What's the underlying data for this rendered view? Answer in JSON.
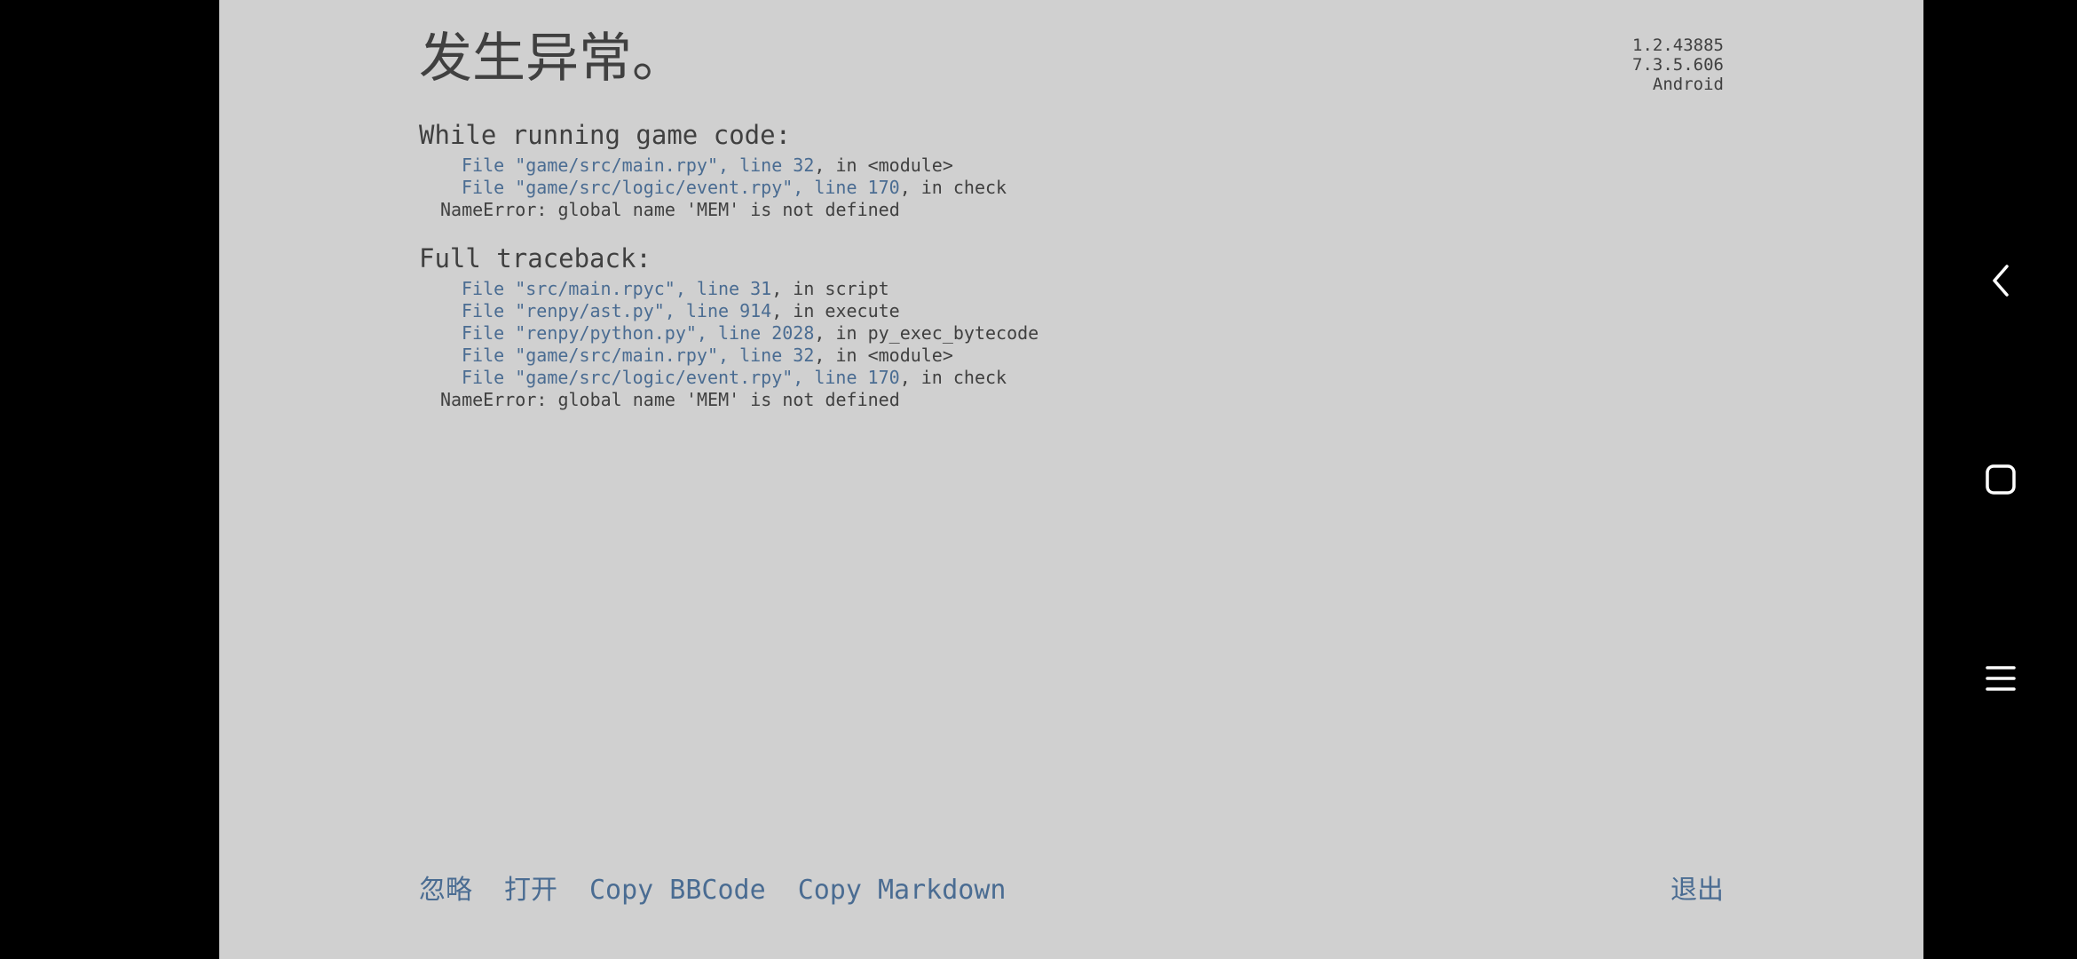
{
  "title": "发生异常。",
  "version": {
    "line1": "1.2.43885",
    "line2": "7.3.5.606",
    "line3": "Android"
  },
  "game_code": {
    "heading": "While running game code:",
    "lines": [
      {
        "loc": "File \"game/src/main.rpy\", line 32",
        "rest": ", in <module>"
      },
      {
        "loc": "File \"game/src/logic/event.rpy\", line 170",
        "rest": ", in check"
      }
    ],
    "error": "NameError: global name 'MEM' is not defined"
  },
  "full_traceback": {
    "heading": "Full traceback:",
    "lines": [
      {
        "loc": "File \"src/main.rpyc\", line 31",
        "rest": ", in script"
      },
      {
        "loc": "File \"renpy/ast.py\", line 914",
        "rest": ", in execute"
      },
      {
        "loc": "File \"renpy/python.py\", line 2028",
        "rest": ", in py_exec_bytecode"
      },
      {
        "loc": "File \"game/src/main.rpy\", line 32",
        "rest": ", in <module>"
      },
      {
        "loc": "File \"game/src/logic/event.rpy\", line 170",
        "rest": ", in check"
      }
    ],
    "error": "NameError: global name 'MEM' is not defined"
  },
  "buttons": {
    "ignore": "忽略",
    "open": "打开",
    "copy_bbcode": "Copy BBCode",
    "copy_markdown": "Copy Markdown",
    "quit": "退出"
  },
  "nav": {
    "back_icon": "back-icon",
    "home_icon": "home-icon",
    "recents_icon": "recents-icon"
  },
  "colors": {
    "background": "#d0d0d0",
    "text": "#404040",
    "link": "#4a6c92",
    "navbar": "#000000"
  }
}
